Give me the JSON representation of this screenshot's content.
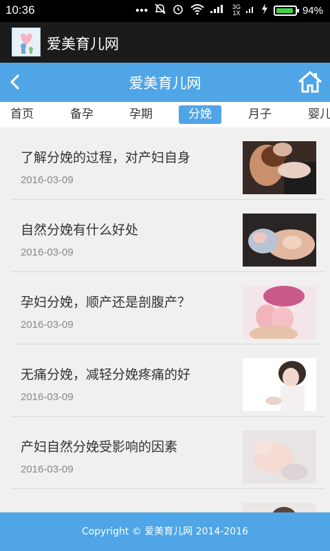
{
  "status_bar": {
    "time": "10:36",
    "network": "3G",
    "network_sub": "1X",
    "battery": "94%"
  },
  "app_bar": {
    "title": "爱美育儿网"
  },
  "header": {
    "title": "爱美育儿网"
  },
  "tabs": [
    {
      "label": "首页"
    },
    {
      "label": "备孕"
    },
    {
      "label": "孕期"
    },
    {
      "label": "分娩",
      "active": true
    },
    {
      "label": "月子"
    },
    {
      "label": "婴儿"
    }
  ],
  "articles": [
    {
      "title": "了解分娩的过程，对产妇自身",
      "date": "2016-03-09"
    },
    {
      "title": "自然分娩有什么好处",
      "date": "2016-03-09"
    },
    {
      "title": "孕妇分娩，顺产还是剖腹产？",
      "date": "2016-03-09"
    },
    {
      "title": "无痛分娩，减轻分娩疼痛的好",
      "date": "2016-03-09"
    },
    {
      "title": "产妇自然分娩受影响的因素",
      "date": "2016-03-09"
    }
  ],
  "footer": {
    "copyright": "Copyright © 爱美育儿网 2014-2016"
  },
  "colors": {
    "accent": "#4fa5e6",
    "battery": "#41d04a"
  }
}
